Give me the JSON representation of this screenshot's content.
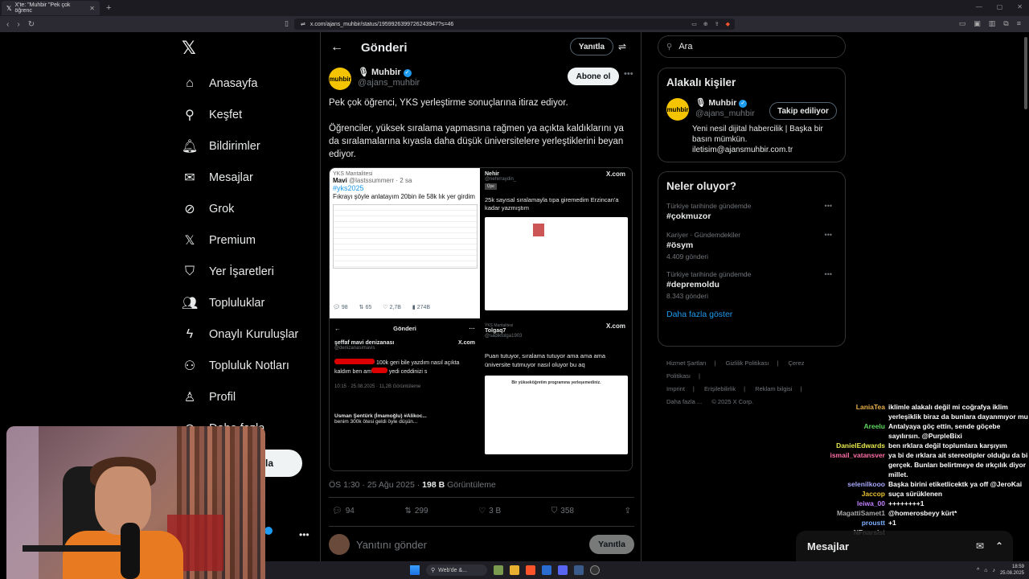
{
  "browser": {
    "tab_title": "X'te: \"Muhbir \"Pek çok öğrenc",
    "url": "x.com/ajans_muhbir/status/1959926399726243947?s=46"
  },
  "sidebar": {
    "items": [
      {
        "label": "Anasayfa",
        "icon": "home-icon"
      },
      {
        "label": "Keşfet",
        "icon": "search-icon"
      },
      {
        "label": "Bildirimler",
        "icon": "bell-icon"
      },
      {
        "label": "Mesajlar",
        "icon": "mail-icon"
      },
      {
        "label": "Grok",
        "icon": "grok-icon"
      },
      {
        "label": "Premium",
        "icon": "x-icon"
      },
      {
        "label": "Yer İşaretleri",
        "icon": "bookmark-icon"
      },
      {
        "label": "Topluluklar",
        "icon": "communities-icon"
      },
      {
        "label": "Onaylı Kuruluşlar",
        "icon": "lightning-icon"
      },
      {
        "label": "Topluluk Notları",
        "icon": "notes-icon"
      },
      {
        "label": "Profil",
        "icon": "person-icon"
      },
      {
        "label": "Daha fazla",
        "icon": "more-circle-icon"
      }
    ],
    "post_button_label": "la"
  },
  "main": {
    "header_title": "Gönderi",
    "reply_pill": "Yanıtla",
    "author": {
      "display_name": "Muhbir",
      "handle": "@ajans_muhbir",
      "avatar_text": "muhbir"
    },
    "follow_label": "Abone ol",
    "text_p1": "Pek çok öğrenci, YKS yerleştirme sonuçlarına itiraz ediyor.",
    "text_p2": "Öğrenciler, yüksek sıralama yapmasına rağmen ya açıkta kaldıklarını ya da sıralamalarına kıyasla daha düşük üniversitelere yerleştiklerini beyan ediyor.",
    "media": {
      "m1": {
        "source": "YKS Mantalitesi",
        "name": "Mavi",
        "handle": "@lastssummerr · 2 sa",
        "tag": "#yks2025",
        "text": "Fıkrayı şöyle anlatayım 20bin ile 58k lık yer girdim",
        "stats": [
          "98",
          "65",
          "2,7B",
          "274B"
        ]
      },
      "m2": {
        "who": "Nehir",
        "handle": "@nehirraydin_",
        "badge": "Üye",
        "xcom": "X.com",
        "text": "25k sayısal sıralamayla tıpa giremedim Erzincan'a kadar yazmıştım"
      },
      "m3": {
        "header": "Gönderi",
        "poster": "şeffaf mavi denizanası",
        "poster_handle": "@denizanasimavis",
        "xcom": "X.com",
        "text1": "100k geri bile yazdım nasıl açıkta kaldım ben am",
        "text2": "yedi ceddinizi s",
        "meta": "10:15 · 25.08.2025 · 11,2B Görüntüleme",
        "reply_user": "Usman Şentürk (İmamoğlu) #Alikoc...",
        "reply_text": "benim 300k ötesi geldi öyle düşün..."
      },
      "m4": {
        "source": "YKS Mantalitesi",
        "who": "Tolgaq7",
        "handle": "@sadiktolga1903",
        "badge": "Üye",
        "xcom": "X.com",
        "text": "Puan tutuyor, sıralama tutuyor ama ama ama üniversite tutmuyor nasıl oluyor bu aq",
        "doc_title": "Bir yükseköğretim programına yerleşemediniz."
      }
    },
    "timestamp": "ÖS 1:30 · 25 Ağu 2025 · ",
    "views_count": "198 B",
    "views_label": "Görüntüleme",
    "actions": {
      "replies": "94",
      "reposts": "299",
      "likes": "3 B",
      "bookmarks": "358"
    },
    "compose_placeholder": "Yanıtını gönder",
    "compose_button": "Yanıtla"
  },
  "right": {
    "search_placeholder": "Ara",
    "related": {
      "title": "Alakalı kişiler",
      "name": "Muhbir",
      "handle": "@ajans_muhbir",
      "button": "Takip ediliyor",
      "bio": "Yeni nesil dijital habercilik | Başka bir basın mümkün. iletisim@ajansmuhbir.com.tr"
    },
    "trends": {
      "title": "Neler oluyor?",
      "items": [
        {
          "context": "Türkiye tarihinde gündemde",
          "name": "#çokmuzor",
          "count": ""
        },
        {
          "context": "Kariyer · Gündemdekiler",
          "name": "#ösym",
          "count": "4.409 gönderi"
        },
        {
          "context": "Türkiye tarihinde gündemde",
          "name": "#depremoldu",
          "count": "8.343 gönderi"
        }
      ],
      "more": "Daha fazla göster"
    },
    "footer": {
      "links": [
        "Hizmet Şartları",
        "Gizlilik Politikası",
        "Çerez Politikası",
        "Imprint",
        "Erişilebilirlik",
        "Reklam bilgisi",
        "Daha fazla ...",
        "© 2025 X Corp."
      ]
    }
  },
  "chat": [
    {
      "user": "LaniaTea",
      "color": "#e8b04a",
      "msg": "iklimle alakalı değil mi coğrafya iklim yerleşiklik biraz da bunlara dayanmıyor mu"
    },
    {
      "user": "Areelu",
      "color": "#5ed65e",
      "msg": "Antalyaya göç ettin, sende göçebe sayılırsın. @PurpleBixi"
    },
    {
      "user": "DanielEdwards",
      "color": "#e8e850",
      "msg": "ben ırklara değil toplumlara karşıyım"
    },
    {
      "user": "ismail_vatansver",
      "color": "#ff6fa5",
      "msg": "ya bi de ırklara ait stereotipler olduğu da bi gerçek. Bunları belirtmeye de ırkçılık diyor millet."
    },
    {
      "user": "selenilkooo",
      "color": "#a8a8ff",
      "msg": "Başka birini etiketlicektk ya off @JeroKai"
    },
    {
      "user": "Jaccop",
      "color": "#e8c030",
      "msg": "suça sürüklenen"
    },
    {
      "user": "leiwa_00",
      "color": "#c080ff",
      "msg": "++++++++1"
    },
    {
      "user": "MagattiSamet1",
      "color": "#aaaaaa",
      "msg": "@homerosbeyy kürt*"
    },
    {
      "user": "proustt",
      "color": "#7ab0ff",
      "msg": "+1"
    },
    {
      "user": "NFnarsist",
      "color": "#cccccc",
      "msg": ""
    }
  ],
  "messages_dock": {
    "label": "Mesajlar"
  },
  "taskbar": {
    "search": "Web'de &...",
    "time": "18:59",
    "date": "25.08.2025"
  }
}
